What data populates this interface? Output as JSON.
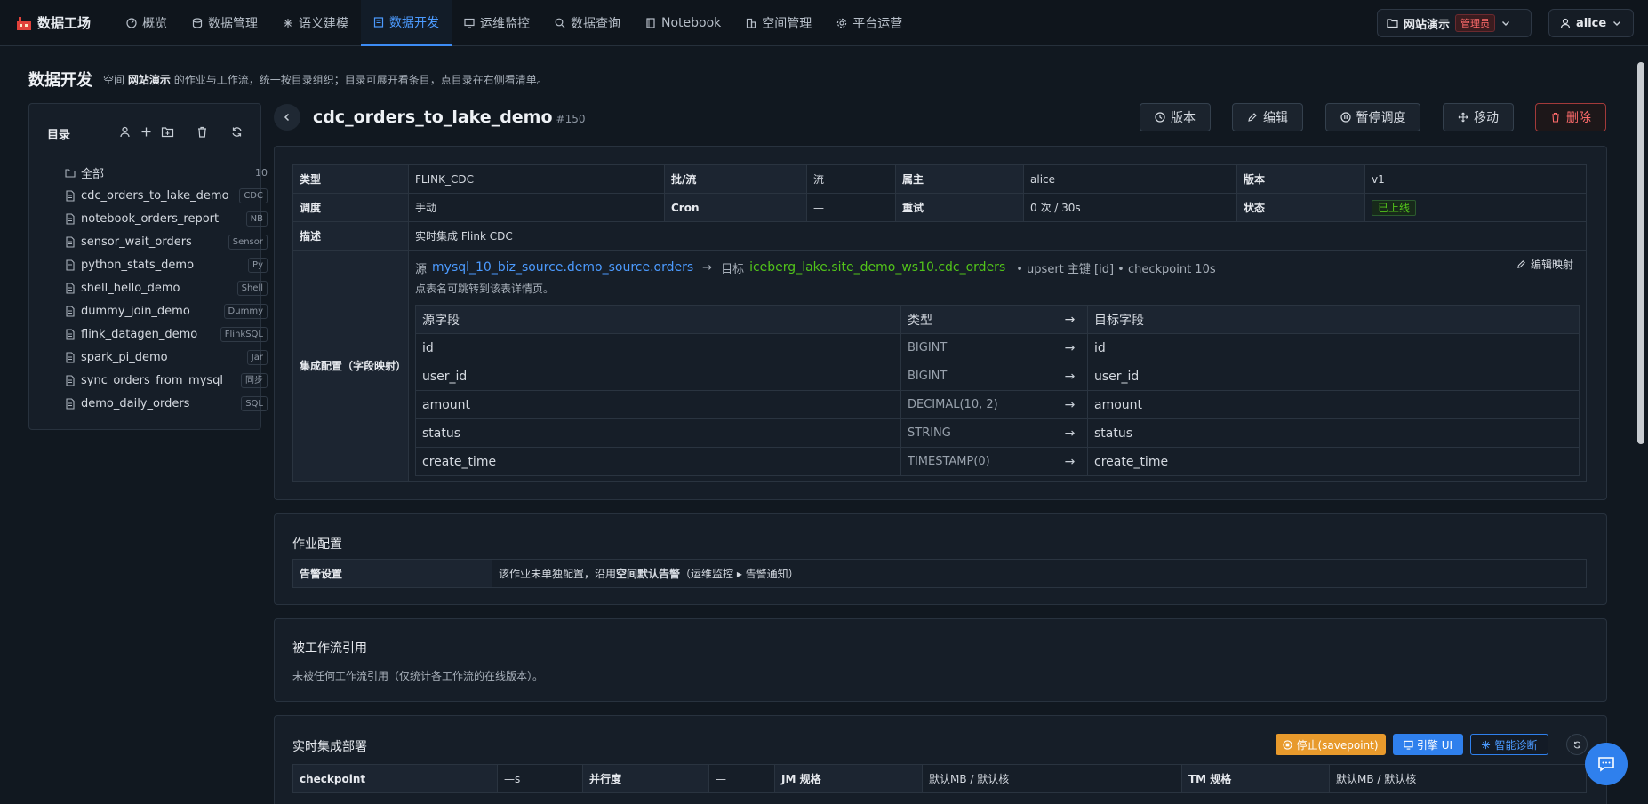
{
  "app": {
    "brand": "数据工场"
  },
  "nav": [
    {
      "label": "概览",
      "icon": "gauge-icon"
    },
    {
      "label": "数据管理",
      "icon": "database-icon"
    },
    {
      "label": "语义建模",
      "icon": "sparkle-icon"
    },
    {
      "label": "数据开发",
      "icon": "code-file-icon",
      "active": true
    },
    {
      "label": "运维监控",
      "icon": "monitor-icon"
    },
    {
      "label": "数据查询",
      "icon": "search-icon"
    },
    {
      "label": "Notebook",
      "icon": "notebook-icon"
    },
    {
      "label": "空间管理",
      "icon": "building-icon"
    },
    {
      "label": "平台运营",
      "icon": "gear-icon"
    }
  ],
  "space": {
    "name": "网站演示",
    "role": "管理员"
  },
  "user": {
    "name": "alice"
  },
  "page": {
    "title": "数据开发",
    "subtitle_pre": "空间",
    "subtitle_space": "网站演示",
    "subtitle_post": "的作业与工作流，统一按目录组织；目录可展开看条目，点目录在右侧看清单。"
  },
  "sidebar": {
    "title": "目录",
    "items": [
      {
        "name": "全部",
        "count": "10",
        "folder": true
      },
      {
        "name": "cdc_orders_to_lake_demo",
        "tag": "CDC"
      },
      {
        "name": "notebook_orders_report",
        "tag": "NB"
      },
      {
        "name": "sensor_wait_orders",
        "tag": "Sensor"
      },
      {
        "name": "python_stats_demo",
        "tag": "Py"
      },
      {
        "name": "shell_hello_demo",
        "tag": "Shell"
      },
      {
        "name": "dummy_join_demo",
        "tag": "Dummy"
      },
      {
        "name": "flink_datagen_demo",
        "tag": "FlinkSQL"
      },
      {
        "name": "spark_pi_demo",
        "tag": "Jar"
      },
      {
        "name": "sync_orders_from_mysql",
        "tag": "同步"
      },
      {
        "name": "demo_daily_orders",
        "tag": "SQL"
      }
    ]
  },
  "job": {
    "name": "cdc_orders_to_lake_demo",
    "id": "#150",
    "buttons": {
      "version": "版本",
      "edit": "编辑",
      "pause": "暂停调度",
      "move": "移动",
      "delete": "删除"
    },
    "info": {
      "type_k": "类型",
      "type_v": "FLINK_CDC",
      "mode_k": "批/流",
      "mode_v": "流",
      "owner_k": "属主",
      "owner_v": "alice",
      "version_k": "版本",
      "version_v": "v1",
      "schedule_k": "调度",
      "schedule_v": "手动",
      "cron_k": "Cron",
      "cron_v": "—",
      "retry_k": "重试",
      "retry_v": "0 次 / 30s",
      "status_k": "状态",
      "status_v": "已上线",
      "desc_k": "描述",
      "desc_v": "实时集成 Flink CDC",
      "integ_k": "集成配置（字段映射）"
    },
    "mapping": {
      "src_label": "源",
      "src_table": "mysql_10_biz_source.demo_source.orders",
      "arrow": "→",
      "dst_label": "目标",
      "dst_table": "iceberg_lake.site_demo_ws10.cdc_orders",
      "extra": "• upsert 主键 [id] • checkpoint 10s",
      "note": "点表名可跳转到该表详情页。",
      "edit": "编辑映射",
      "headers": [
        "源字段",
        "类型",
        "→",
        "目标字段"
      ],
      "rows": [
        {
          "src": "id",
          "type": "BIGINT",
          "arrow": "→",
          "dst": "id"
        },
        {
          "src": "user_id",
          "type": "BIGINT",
          "arrow": "→",
          "dst": "user_id"
        },
        {
          "src": "amount",
          "type": "DECIMAL(10, 2)",
          "arrow": "→",
          "dst": "amount"
        },
        {
          "src": "status",
          "type": "STRING",
          "arrow": "→",
          "dst": "status"
        },
        {
          "src": "create_time",
          "type": "TIMESTAMP(0)",
          "arrow": "→",
          "dst": "create_time"
        }
      ]
    }
  },
  "job_config": {
    "title": "作业配置",
    "alert_k": "告警设置",
    "alert_pre": "该作业未单独配置，沿用",
    "alert_bold": "空间默认告警",
    "alert_post": "（运维监控 ▸ 告警通知）"
  },
  "refs": {
    "title": "被工作流引用",
    "text": "未被任何工作流引用（仅统计各工作流的在线版本）。"
  },
  "deploy": {
    "title": "实时集成部署",
    "stop": "停止(savepoint)",
    "engine": "引擎 UI",
    "diagnose": "智能诊断",
    "checkpoint_k": "checkpoint",
    "checkpoint_v": "—s",
    "parallel_k": "并行度",
    "parallel_v": "—",
    "jm_k": "JM 规格",
    "jm_v": "默认MB / 默认核",
    "tm_k": "TM 规格",
    "tm_v": "默认MB / 默认核"
  },
  "colors": {
    "accent": "#4c9bff",
    "success": "#52c41a",
    "danger": "#ff6b6b",
    "warning": "#f0a020"
  }
}
